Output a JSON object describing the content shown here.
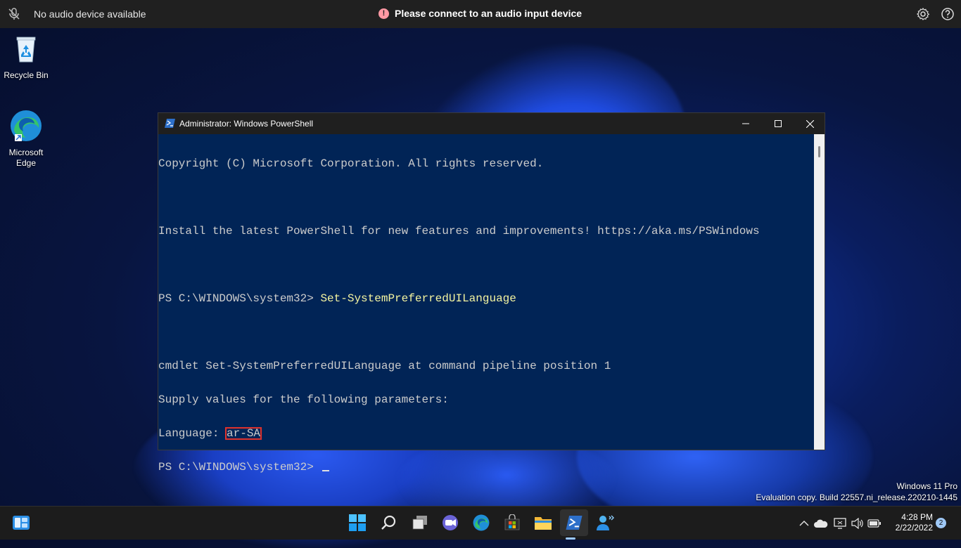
{
  "top_bar": {
    "left_status": "No audio device available",
    "alert_text": "Please connect to an audio input device",
    "alert_icon": "!",
    "icons": [
      "mic-off-icon",
      "gear-icon",
      "help-icon"
    ]
  },
  "desktop": {
    "icons": [
      {
        "label": "Recycle Bin",
        "icon": "recycle-bin-icon"
      },
      {
        "label_line1": "Microsoft",
        "label_line2": "Edge",
        "icon": "edge-icon"
      }
    ]
  },
  "powershell": {
    "title": "Administrator: Windows PowerShell",
    "lines": {
      "l1": "Copyright (C) Microsoft Corporation. All rights reserved.",
      "l2": "Install the latest PowerShell for new features and improvements! https://aka.ms/PSWindows",
      "prompt": "PS C:\\WINDOWS\\system32> ",
      "command": "Set-SystemPreferredUILanguage",
      "l4": "cmdlet Set-SystemPreferredUILanguage at command pipeline position 1",
      "l5": "Supply values for the following parameters:",
      "param_label": "Language: ",
      "param_value": "ar-SA"
    }
  },
  "watermark": {
    "edition": "Windows 11 Pro",
    "build": "Evaluation copy. Build 22557.ni_release.220210-1445"
  },
  "taskbar": {
    "apps": [
      "widgets-icon",
      "start-icon",
      "search-icon",
      "task-view-icon",
      "chat-icon",
      "edge-icon",
      "store-icon",
      "file-explorer-icon",
      "powershell-icon",
      "people-icon"
    ],
    "tray": [
      "chevron-up-icon",
      "onedrive-icon",
      "display-icon",
      "volume-icon",
      "battery-icon"
    ],
    "time": "4:28 PM",
    "date": "2/22/2022",
    "notification_count": "2",
    "accent": "#9ac7ff"
  }
}
